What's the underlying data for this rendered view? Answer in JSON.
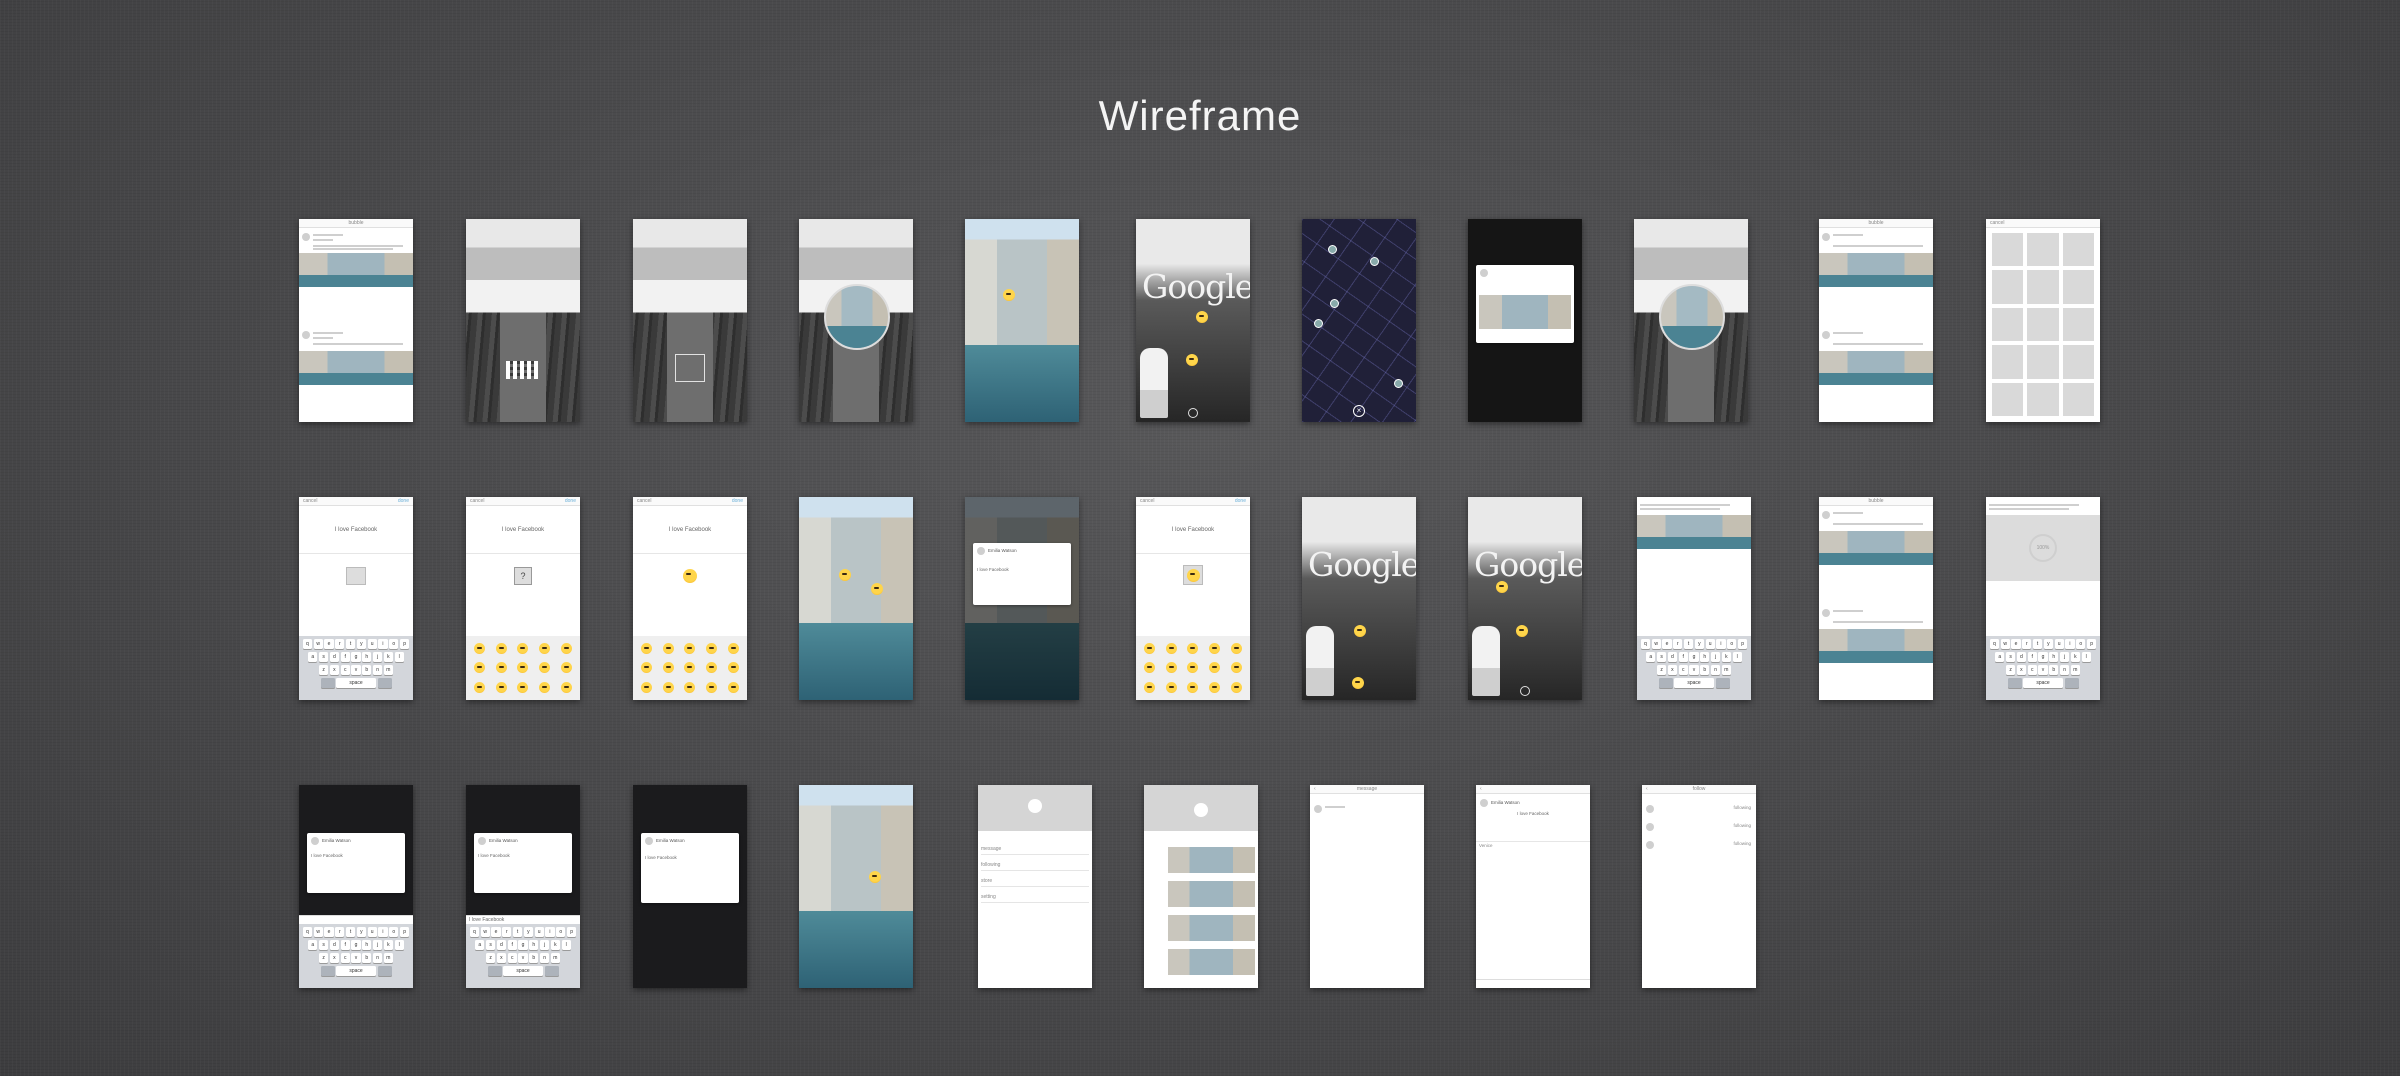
{
  "page": {
    "title": "Wireframe"
  },
  "keyboard": {
    "row1": [
      "q",
      "w",
      "e",
      "r",
      "t",
      "y",
      "u",
      "i",
      "o",
      "p"
    ],
    "row2": [
      "a",
      "s",
      "d",
      "f",
      "g",
      "h",
      "j",
      "k",
      "l"
    ],
    "row3": [
      "z",
      "x",
      "c",
      "v",
      "b",
      "n",
      "m"
    ],
    "space": "space"
  },
  "screens": {
    "feed_title": "bubble",
    "cancel": "cancel",
    "done": "done",
    "field_placeholder": "I love Facebook",
    "loading": "100%",
    "google_word": "Google",
    "message_title": "message",
    "follow_title": "follow",
    "following": "following",
    "settings_items": [
      "message",
      "following",
      "store",
      "setting"
    ],
    "venice": "Venice",
    "user_name": "Emilia Watson",
    "comment_text": "I love Facebook",
    "close_glyph": "×"
  },
  "colors": {
    "background": "#4a4a4c",
    "title_text": "#f4f4f4",
    "accent": "#6ab0d8",
    "emoji": "#ffd54a"
  }
}
